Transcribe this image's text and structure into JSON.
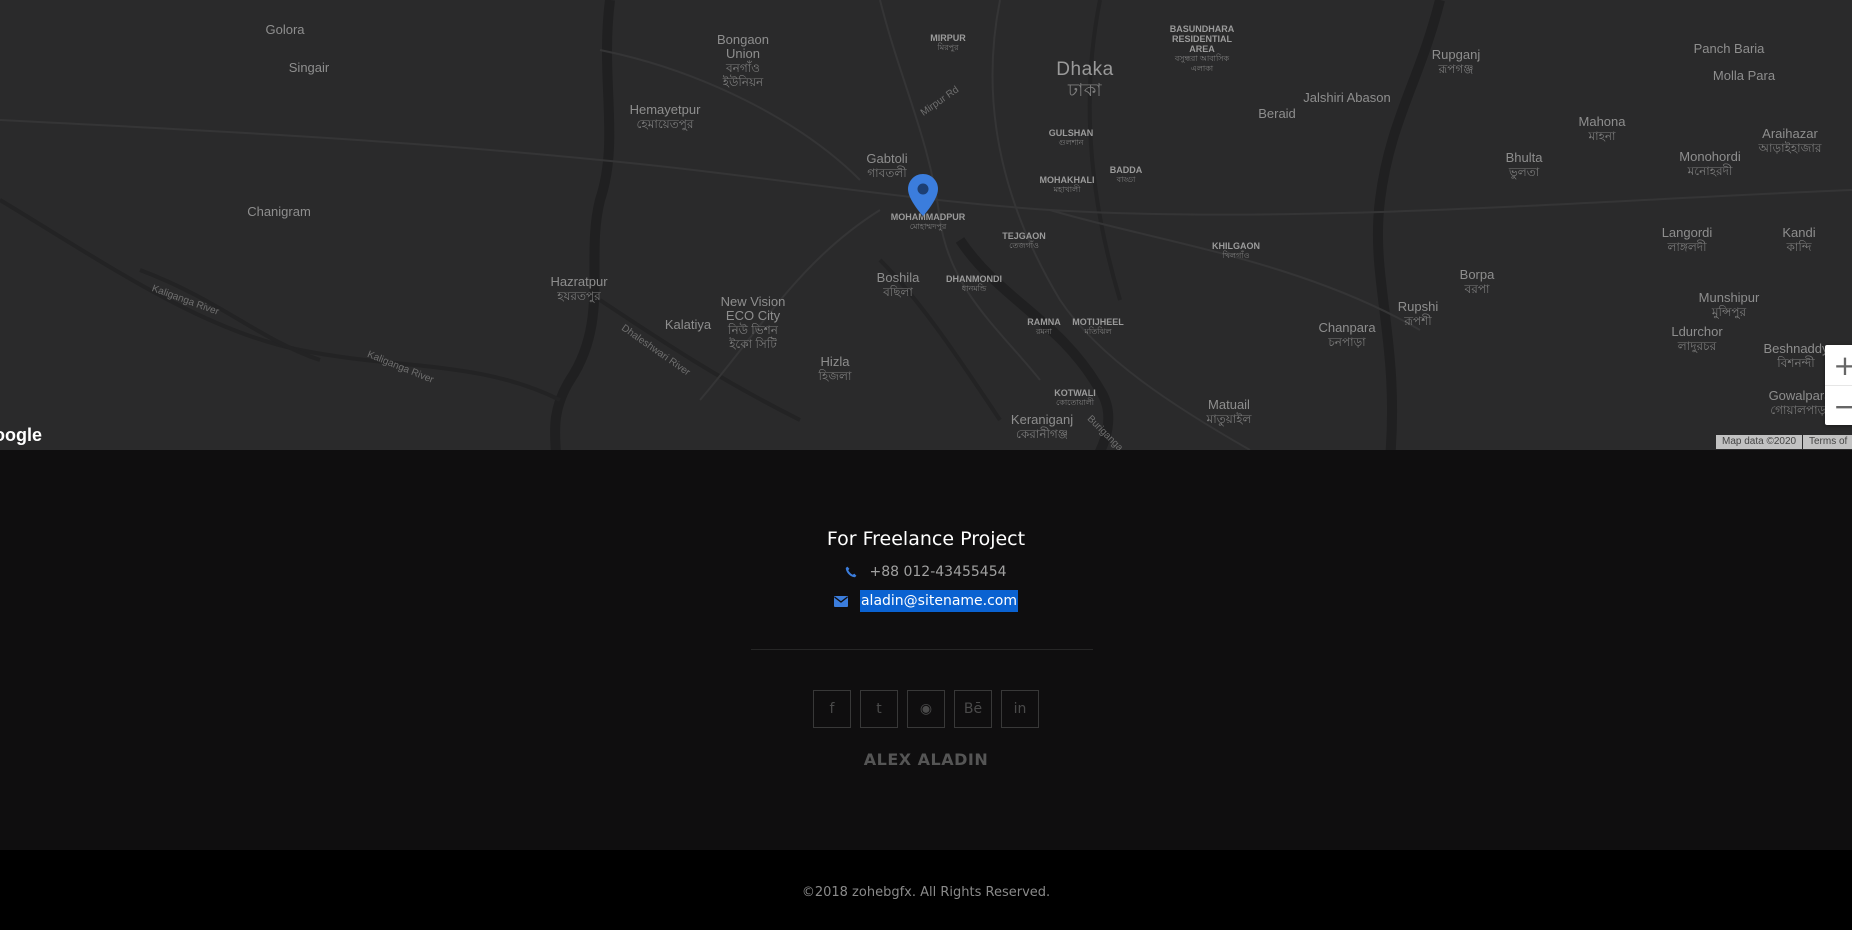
{
  "map": {
    "places": [
      {
        "name": "Golora",
        "bn": ""
      },
      {
        "name": "Singair",
        "bn": ""
      },
      {
        "name": "Bongaon Union",
        "bn": "বনগাঁও ইউনিয়ন"
      },
      {
        "name": "MIRPUR",
        "bn": "মিরপুর"
      },
      {
        "name": "BASUNDHARA RESIDENTIAL AREA",
        "bn": "বসুন্ধরা আবাসিক এলাকা"
      },
      {
        "name": "Dhaka",
        "bn": "ঢাকা"
      },
      {
        "name": "Rupganj",
        "bn": "রূপগঞ্জ"
      },
      {
        "name": "Panch Baria",
        "bn": ""
      },
      {
        "name": "Molla Para",
        "bn": ""
      },
      {
        "name": "Hemayetpur",
        "bn": "হেমায়েতপুর"
      },
      {
        "name": "Jalshiri Abason",
        "bn": ""
      },
      {
        "name": "Beraid",
        "bn": ""
      },
      {
        "name": "Mahona",
        "bn": "মাহনা"
      },
      {
        "name": "Araihazar",
        "bn": "আড়াইহাজার"
      },
      {
        "name": "GULSHAN",
        "bn": "গুলশান"
      },
      {
        "name": "Gabtoli",
        "bn": "গাবতলী"
      },
      {
        "name": "Monohordi",
        "bn": "মনোহরদী"
      },
      {
        "name": "Bhulta",
        "bn": "ভুলতা"
      },
      {
        "name": "BADDA",
        "bn": "বাড্ডা"
      },
      {
        "name": "MOHAKHALI",
        "bn": "মহাখালী"
      },
      {
        "name": "MOHAMMADPUR",
        "bn": "মোহাম্মদপুর"
      },
      {
        "name": "Chanigram",
        "bn": ""
      },
      {
        "name": "TEJGAON",
        "bn": "তেজগাঁও"
      },
      {
        "name": "Langordi",
        "bn": "লাঙ্গলদী"
      },
      {
        "name": "Kandi",
        "bn": "কান্দি"
      },
      {
        "name": "KHILGAON",
        "bn": "খিলগাঁও"
      },
      {
        "name": "Boshila",
        "bn": "বছিলা"
      },
      {
        "name": "DHANMONDI",
        "bn": "ধানমন্ডি"
      },
      {
        "name": "Hazratpur",
        "bn": "হযরতপুর"
      },
      {
        "name": "Borpa",
        "bn": "বরপা"
      },
      {
        "name": "New Vision ECO City",
        "bn": "নিউ ভিশন ইকো সিটি"
      },
      {
        "name": "Munshipur",
        "bn": "মুন্সিপুর"
      },
      {
        "name": "RAMNA",
        "bn": "রমনা"
      },
      {
        "name": "MOTIJHEEL",
        "bn": "মতিঝিল"
      },
      {
        "name": "Kalatiya",
        "bn": ""
      },
      {
        "name": "Rupshi",
        "bn": "রূপশী"
      },
      {
        "name": "Chanpara",
        "bn": "চনপাড়া"
      },
      {
        "name": "Ldurchor",
        "bn": "লাদুরচর"
      },
      {
        "name": "Beshnaddy",
        "bn": "বিশনন্দী"
      },
      {
        "name": "Hizla",
        "bn": "হিজলা"
      },
      {
        "name": "KOTWALI",
        "bn": "কোতোয়ালী"
      },
      {
        "name": "Gowalpara",
        "bn": "গোয়ালপাড়া"
      },
      {
        "name": "Matuail",
        "bn": "মাতুয়াইল"
      },
      {
        "name": "Keraniganj",
        "bn": "কেরানীগঞ্জ"
      }
    ],
    "rivers": [
      "Kaliganga River",
      "Kaliganga River",
      "Dhaleshwari River",
      "Mirpur Rd",
      "Buriganga"
    ],
    "google_logo": "oogle",
    "zoom_in": "+",
    "zoom_out": "−",
    "map_data": "Map data ©2020",
    "terms": "Terms of"
  },
  "footer": {
    "title": "For Freelance Project",
    "phone": "+88 012-43455454",
    "email": "aladin@sitename.com",
    "socials": [
      {
        "icon": "facebook-icon",
        "glyph": "f"
      },
      {
        "icon": "twitter-icon",
        "glyph": "t"
      },
      {
        "icon": "github-icon",
        "glyph": "◉"
      },
      {
        "icon": "behance-icon",
        "glyph": "Bē"
      },
      {
        "icon": "linkedin-icon",
        "glyph": "in"
      }
    ],
    "brand": "ALEX ALADIN",
    "copyright": "©2018 zohebgfx. All Rights Reserved."
  },
  "colors": {
    "accent": "#3b7ddd",
    "selection": "#0a62d1",
    "map_bg": "#2a2a2b",
    "footer_bg": "#0f0e0f"
  }
}
